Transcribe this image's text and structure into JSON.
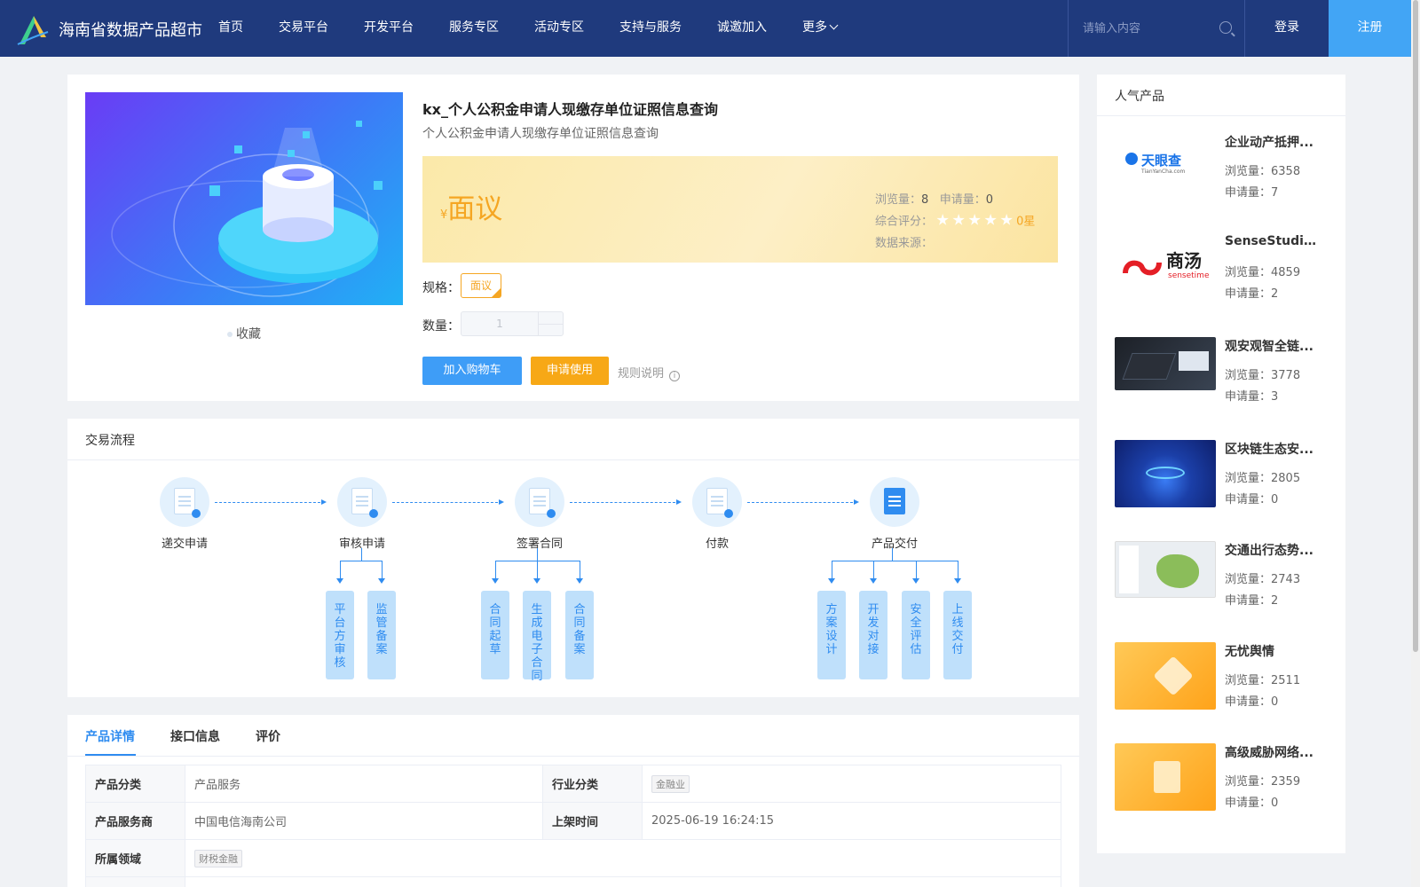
{
  "header": {
    "brand": "海南省数据产品超市",
    "nav": [
      "首页",
      "交易平台",
      "开发平台",
      "服务专区",
      "活动专区",
      "支持与服务",
      "诚邀加入",
      "更多"
    ],
    "search_placeholder": "请输入内容",
    "login": "登录",
    "register": "注册"
  },
  "product": {
    "title": "kx_个人公积金申请人现缴存单位证照信息查询",
    "subtitle": "个人公积金申请人现缴存单位证照信息查询",
    "currency": "¥",
    "price": "面议",
    "views_label": "浏览量：",
    "views": "8",
    "apply_label": "申请量：",
    "apply": "0",
    "rating_label": "综合评分：",
    "rating": "0星",
    "stars_filled": 0,
    "stars_total": 5,
    "source_label": "数据来源：",
    "favorite": "收藏",
    "spec_label": "规格：",
    "spec_value": "面议",
    "qty_label": "数量：",
    "qty_value": "1",
    "btn_cart": "加入购物车",
    "btn_apply": "申请使用",
    "rules": "规则说明"
  },
  "process": {
    "title": "交易流程",
    "steps": [
      "递交申请",
      "审核申请",
      "签署合同",
      "付款",
      "产品交付"
    ],
    "sub": {
      "audit": [
        "平台方审核",
        "监管备案"
      ],
      "contract": [
        "合同起草",
        "生成电子合同",
        "合同备案"
      ],
      "delivery": [
        "方案设计",
        "开发对接",
        "安全评估",
        "上线交付"
      ]
    }
  },
  "tabs": [
    "产品详情",
    "接口信息",
    "评价"
  ],
  "details": {
    "category_label": "产品分类",
    "category": "产品服务",
    "industry_label": "行业分类",
    "industry": "金融业",
    "provider_label": "产品服务商",
    "provider": "中国电信海南公司",
    "listed_label": "上架时间",
    "listed": "2025-06-19 16:24:15",
    "domain_label": "所属领域",
    "domain": "财税金融"
  },
  "sidebar": {
    "title": "人气产品",
    "views_label": "浏览量：",
    "apply_label": "申请量：",
    "items": [
      {
        "name": "企业动产抵押...",
        "views": "6358",
        "apply": "7",
        "logo_text": "天眼查",
        "logo_sub": "TianYanCha.com"
      },
      {
        "name": "SenseStudio...",
        "views": "4859",
        "apply": "2",
        "logo_text": "商汤",
        "logo_sub": "sensetime"
      },
      {
        "name": "观安观智全链...",
        "views": "3778",
        "apply": "3"
      },
      {
        "name": "区块链生态安...",
        "views": "2805",
        "apply": "0"
      },
      {
        "name": "交通出行态势...",
        "views": "2743",
        "apply": "2"
      },
      {
        "name": "无忧舆情",
        "views": "2511",
        "apply": "0"
      },
      {
        "name": "高级威胁网络...",
        "views": "2359",
        "apply": "0"
      }
    ]
  },
  "colors": {
    "header_bg": "#1f3a7d",
    "accent": "#3e9df7",
    "price": "#f5a623",
    "apply_btn": "#f7a816"
  }
}
